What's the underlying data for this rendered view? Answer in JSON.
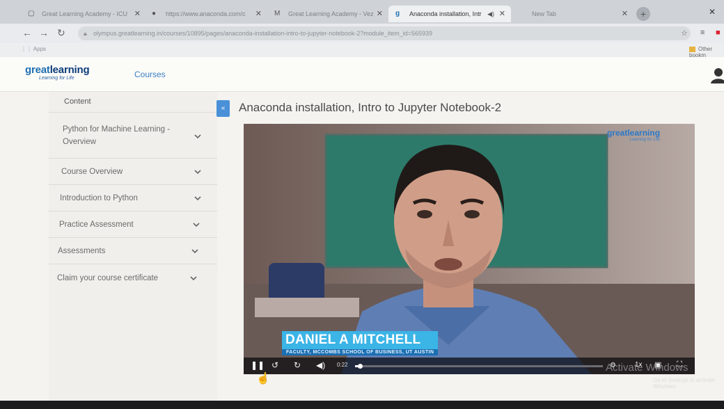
{
  "browser": {
    "tabs": [
      {
        "title": "Great Learning Academy - ICU",
        "active": false
      },
      {
        "title": "https://www.anaconda.com/c",
        "active": false
      },
      {
        "title": "Great Learning Academy - Vez",
        "active": false
      },
      {
        "title": "Anaconda installation, Intr",
        "active": true
      },
      {
        "title": "New Tab",
        "active": false
      }
    ],
    "url": "olympus.greatlearning.in/courses/10895/pages/anaconda-installation-intro-to-jupyter-notebook-2?module_item_id=565939",
    "bookmarks": {
      "apps": "Apps",
      "other": "Other bookm"
    }
  },
  "site": {
    "logo_main_a": "great",
    "logo_main_b": "learning",
    "logo_tagline": "Learning for Life",
    "nav_courses": "Courses"
  },
  "sidebar": {
    "header": "Content",
    "items": [
      {
        "label": "Python for Machine Learning - Overview"
      },
      {
        "label": "Course Overview"
      },
      {
        "label": "Introduction to Python"
      },
      {
        "label": "Practice Assessment"
      },
      {
        "label": "Assessments"
      },
      {
        "label": "Claim your course certificate"
      }
    ]
  },
  "main": {
    "collapse_label": "«",
    "title": "Anaconda installation, Intro to Jupyter Notebook-2"
  },
  "video": {
    "watermark_main": "greatlearning",
    "watermark_tag": "Learning for Life",
    "speaker_name": "DANIEL A MITCHELL",
    "speaker_subtitle": "FACULTY, MCCOMBS SCHOOL OF BUSINESS, UT AUSTIN",
    "time": "0:22",
    "progress_fraction": 0.02,
    "speed": "1x"
  },
  "os_overlay": {
    "activate": "Activate Windows",
    "activate_sub": "Go to Settings to activate Windows."
  },
  "colors": {
    "accent": "#4a90d9",
    "brand_blue": "#1f6fb2",
    "lower_third": "#3bb4e6"
  }
}
